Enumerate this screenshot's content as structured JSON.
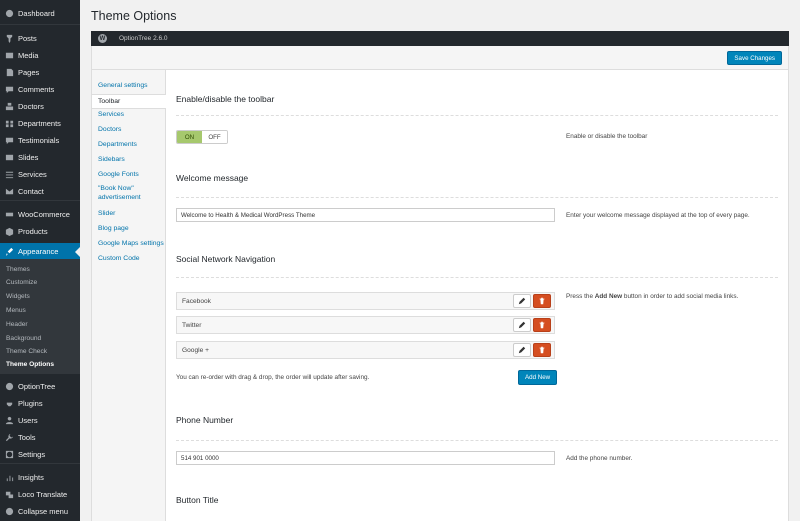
{
  "sidebar": {
    "items": [
      {
        "label": "Dashboard",
        "icon": "dashboard-icon"
      },
      {
        "label": "Posts",
        "icon": "pin-icon"
      },
      {
        "label": "Media",
        "icon": "media-icon"
      },
      {
        "label": "Pages",
        "icon": "page-icon"
      },
      {
        "label": "Comments",
        "icon": "comment-icon"
      },
      {
        "label": "Doctors",
        "icon": "doctors-icon"
      },
      {
        "label": "Departments",
        "icon": "departments-icon"
      },
      {
        "label": "Testimonials",
        "icon": "testimonials-icon"
      },
      {
        "label": "Slides",
        "icon": "slides-icon"
      },
      {
        "label": "Services",
        "icon": "services-icon"
      },
      {
        "label": "Contact",
        "icon": "mail-icon"
      },
      {
        "label": "WooCommerce",
        "icon": "woocommerce-icon"
      },
      {
        "label": "Products",
        "icon": "products-icon"
      },
      {
        "label": "Appearance",
        "icon": "brush-icon"
      },
      {
        "label": "OptionTree",
        "icon": "optiontree-icon"
      },
      {
        "label": "Plugins",
        "icon": "plugin-icon"
      },
      {
        "label": "Users",
        "icon": "users-icon"
      },
      {
        "label": "Tools",
        "icon": "wrench-icon"
      },
      {
        "label": "Settings",
        "icon": "settings-icon"
      },
      {
        "label": "Insights",
        "icon": "insights-icon"
      },
      {
        "label": "Loco Translate",
        "icon": "translate-icon"
      },
      {
        "label": "Collapse menu",
        "icon": "collapse-icon"
      }
    ],
    "submenu": [
      "Themes",
      "Customize",
      "Widgets",
      "Menus",
      "Header",
      "Background",
      "Theme Check",
      "Theme Options"
    ]
  },
  "page": {
    "title": "Theme Options",
    "ot_version": "OptionTree 2.6.0",
    "save_label": "Save Changes"
  },
  "tabs": [
    "General settings",
    "Toolbar",
    "Services",
    "Doctors",
    "Departments",
    "Sidebars",
    "Google Fonts",
    "\"Book Now\" advertisement",
    "Slider",
    "Blog page",
    "Google Maps settings",
    "Custom Code"
  ],
  "sections": {
    "toolbar": {
      "title": "Enable/disable the toolbar",
      "on": "ON",
      "off": "OFF",
      "desc": "Enable or disable the toolbar"
    },
    "welcome": {
      "title": "Welcome message",
      "value": "Welcome to Health & Medical WordPress Theme",
      "desc": "Enter your welcome message displayed at the top of every page."
    },
    "social": {
      "title": "Social Network Navigation",
      "desc_pre": "Press the ",
      "desc_bold": "Add New",
      "desc_post": " button in order to add social media links.",
      "items": [
        "Facebook",
        "Twitter",
        "Google +"
      ],
      "reorder": "You can re-order with drag & drop, the order will update after saving.",
      "add_new": "Add New"
    },
    "phone": {
      "title": "Phone Number",
      "value": "514 901 0000",
      "desc": "Add the phone number."
    },
    "button_title": {
      "title": "Button Title"
    }
  },
  "colors": {
    "admin_bar": "#23282d",
    "accent": "#0073aa",
    "toggle_on": "#a6c86d",
    "delete": "#d54e21"
  }
}
